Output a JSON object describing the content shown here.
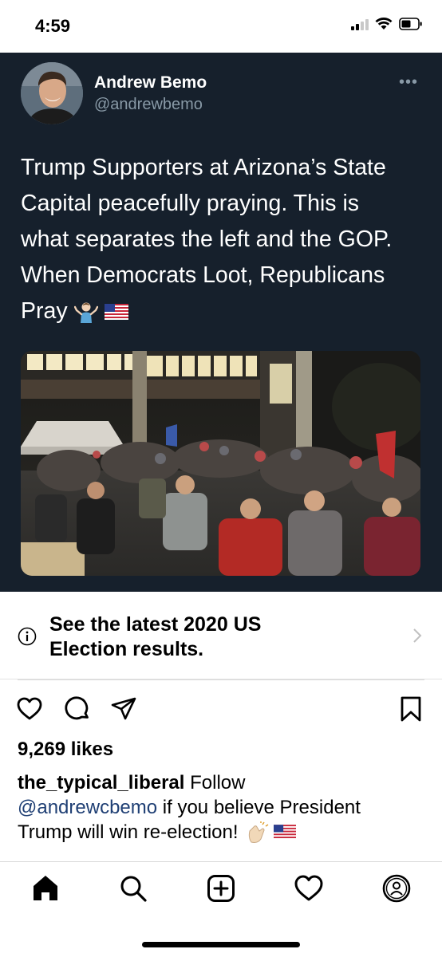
{
  "status_bar": {
    "time": "4:59",
    "icons": [
      "cellular-signal-icon",
      "wifi-icon",
      "battery-icon"
    ]
  },
  "tweet": {
    "author_name": "Andrew Bemo",
    "author_handle": "@andrewbemo",
    "more_icon": "more-dots-icon",
    "text_lines": [
      "Trump Supporters at Arizona’s State",
      "Capital peacefully praying. This is",
      "what separates the left and the GOP.",
      "When Democrats Loot, Republicans",
      "Pray"
    ],
    "emoji": [
      "person-shrugging-emoji",
      "us-flag-emoji"
    ],
    "colors": {
      "background": "#16202c",
      "text": "#ffffff",
      "handle": "#8899a6"
    }
  },
  "election_banner": {
    "icon": "info-icon",
    "line1": "See the latest 2020 US",
    "line2": "Election results.",
    "chevron": "chevron-right-icon"
  },
  "post": {
    "action_icons": [
      "heart-icon",
      "comment-icon",
      "share-icon",
      "bookmark-icon"
    ],
    "likes": "9,269 likes",
    "caption_user": "the_typical_liberal",
    "caption_follow": " Follow",
    "caption_mention": "@andrewcbemo",
    "caption_rest1": " if you believe President",
    "caption_rest2": "Trump will win re-election! ",
    "caption_emoji": [
      "clapping-hands-emoji",
      "us-flag-emoji"
    ]
  },
  "bottom_nav": {
    "items": [
      "home-icon",
      "search-icon",
      "new-post-icon",
      "activity-heart-icon",
      "profile-icon"
    ]
  }
}
